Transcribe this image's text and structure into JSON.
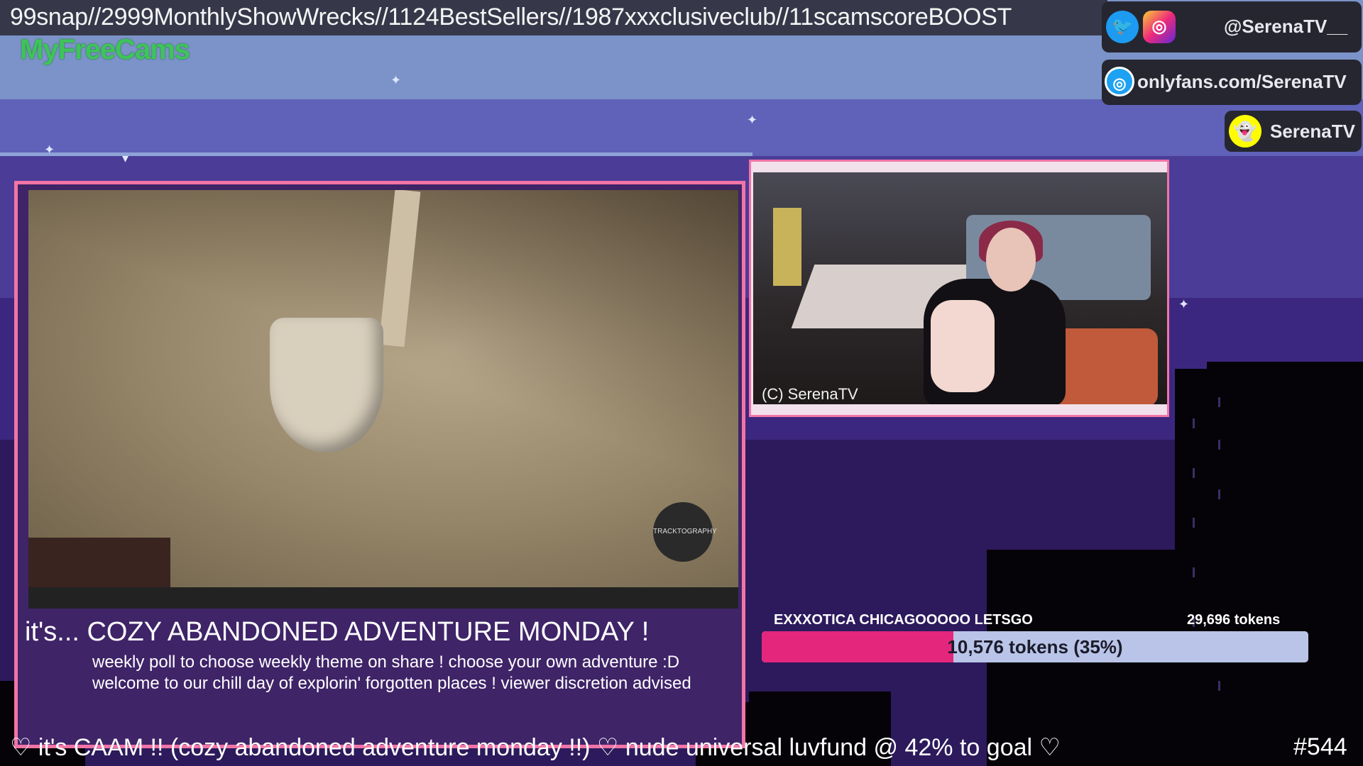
{
  "header": {
    "marquee": "99snap//2999MonthlyShowWrecks//1124BestSellers//1987xxxclusiveclub//11scamscoreBOOST",
    "brand": "MyFreeCams"
  },
  "social": {
    "twitter_handle": "@SerenaTV__",
    "onlyfans": "onlyfans.com/SerenaTV",
    "snapchat": "SerenaTV"
  },
  "main_panel": {
    "title": "it's... COZY ABANDONED ADVENTURE MONDAY !",
    "line1": "weekly poll to choose weekly theme on share ! choose your own adventure :D",
    "line2": "welcome to our chill day of explorin' forgotten places ! viewer discretion advised",
    "watermark": "TRACKTOGRAPHY"
  },
  "cam_panel": {
    "caption": "(C) SerenaTV"
  },
  "goal": {
    "title": "EXXXOTICA CHICAGOOOOO LETSGO",
    "total": "29,696 tokens",
    "progress_label": "10,576 tokens (35%)",
    "progress_fraction": 0.35
  },
  "ticker": {
    "text": "♡ it's CAAM !! (cozy abandoned adventure monday !!) ♡ nude universal luvfund @ 42% to goal ♡",
    "episode": "#544"
  },
  "colors": {
    "accent_pink": "#f274a6",
    "progress_fill": "#e5267d",
    "brand_green": "#3ec45a"
  },
  "icons": [
    "twitter-icon",
    "instagram-icon",
    "onlyfans-icon",
    "snapchat-icon"
  ]
}
